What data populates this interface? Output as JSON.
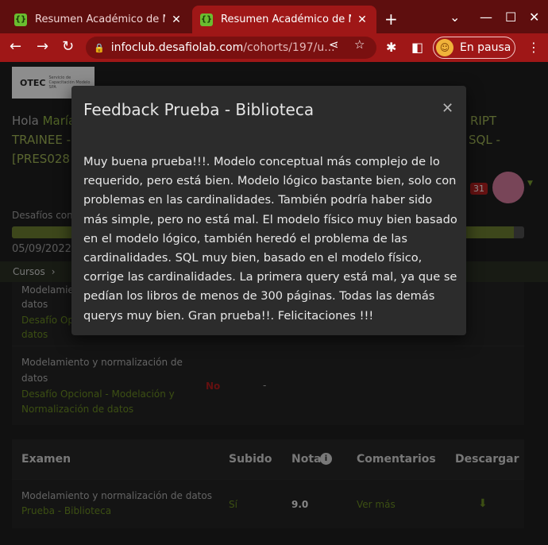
{
  "browser": {
    "tabs": [
      {
        "title": "Resumen Académico de MAF",
        "close": "✕",
        "favicon": "{}"
      },
      {
        "title": "Resumen Académico de MAF",
        "close": "✕",
        "favicon": "{}"
      }
    ],
    "url_host": "infoclub.desafiolab.com",
    "url_path": "/cohorts/197/u...",
    "profile_label": "En pausa"
  },
  "page": {
    "logo_text": "OTEC",
    "logo_sub": "Servicio de Capacitación Modelo SPA",
    "greeting_prefix": "Hola ",
    "greeting_name": "María",
    "greeting_frag_right1": "RIPT",
    "greeting_line2_left": "TRAINEE -",
    "greeting_frag_right2": "SQL -",
    "greeting_line3_left": "[PRES028",
    "notification_count": "31",
    "desafios_label": "Desafíos com",
    "progress_fraction": 0.98,
    "date": "05/09/2022",
    "breadcrumb": "Cursos",
    "row1": {
      "title_line": "Modelamien",
      "title_line2": "datos",
      "link": "Desafío Opci",
      "link2": "datos"
    },
    "row2": {
      "title": "Modelamiento y normalización de",
      "title2": "datos",
      "link": "Desafío Opcional - Modelación y",
      "link2": "Normalización de datos",
      "submitted": "No",
      "grade": "-"
    },
    "exam": {
      "headers": {
        "exam": "Examen",
        "submitted": "Subido",
        "grade": "Nota",
        "comments": "Comentarios",
        "download": "Descargar"
      },
      "row": {
        "title": "Modelamiento y normalización de datos",
        "link": "Prueba - Biblioteca",
        "submitted": "Sí",
        "grade": "9.0",
        "comments": "Ver más"
      }
    }
  },
  "modal": {
    "title": "Feedback Prueba - Biblioteca",
    "close": "✕",
    "body": "Muy buena prueba!!!. Modelo conceptual más complejo de lo requerido, pero está bien. Modelo lógico bastante bien, solo con problemas en las cardinalidades. También podría haber sido más simple, pero no está mal. El modelo físico muy bien basado en el modelo lógico, también heredó el problema de las cardinalidades. SQL muy bien, basado en el modelo físico, corrige las cardinalidades. La primera query está mal, ya que se pedían los libros de menos de 300 páginas. Todas las demás querys muy bien. Gran prueba!!. Felicitaciones !!!"
  },
  "colors": {
    "brand": "#9f1717",
    "accent_green": "#5c7a1e"
  }
}
